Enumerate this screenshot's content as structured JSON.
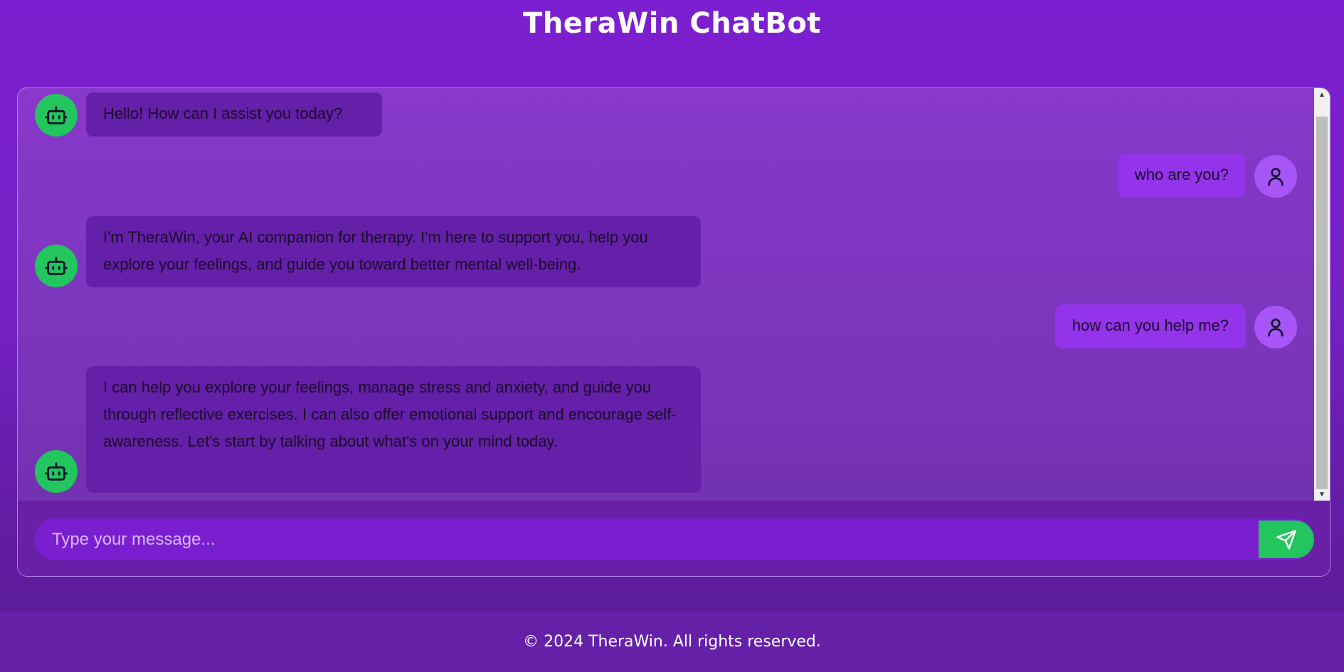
{
  "header": {
    "title": "TheraWin ChatBot"
  },
  "messages": [
    {
      "sender": "bot",
      "avatar_icon": "robot-icon",
      "text": "Hello! How can I assist you today?"
    },
    {
      "sender": "user",
      "avatar_icon": "user-icon",
      "text": "who are you?"
    },
    {
      "sender": "bot",
      "avatar_icon": "robot-icon",
      "text": "I'm TheraWin, your AI companion for therapy. I'm here to support you, help you explore your feelings, and guide you toward better mental well-being."
    },
    {
      "sender": "user",
      "avatar_icon": "user-icon",
      "text": "how can you help me?"
    },
    {
      "sender": "bot",
      "avatar_icon": "robot-icon",
      "text": "I can help you explore your feelings, manage stress and anxiety, and guide you through reflective exercises. I can also offer emotional support and encourage self-awareness. Let's start by talking about what's on your mind today."
    }
  ],
  "composer": {
    "placeholder": "Type your message...",
    "value": "",
    "send_icon": "send-icon"
  },
  "footer": {
    "text": "© 2024 TheraWin. All rights reserved."
  },
  "colors": {
    "background": "#7c1fd0",
    "bot_avatar": "#22c55e",
    "user_avatar": "#a855f7",
    "bot_bubble": "#6420a8",
    "user_bubble": "#9333ea",
    "send_button": "#22c55e"
  }
}
